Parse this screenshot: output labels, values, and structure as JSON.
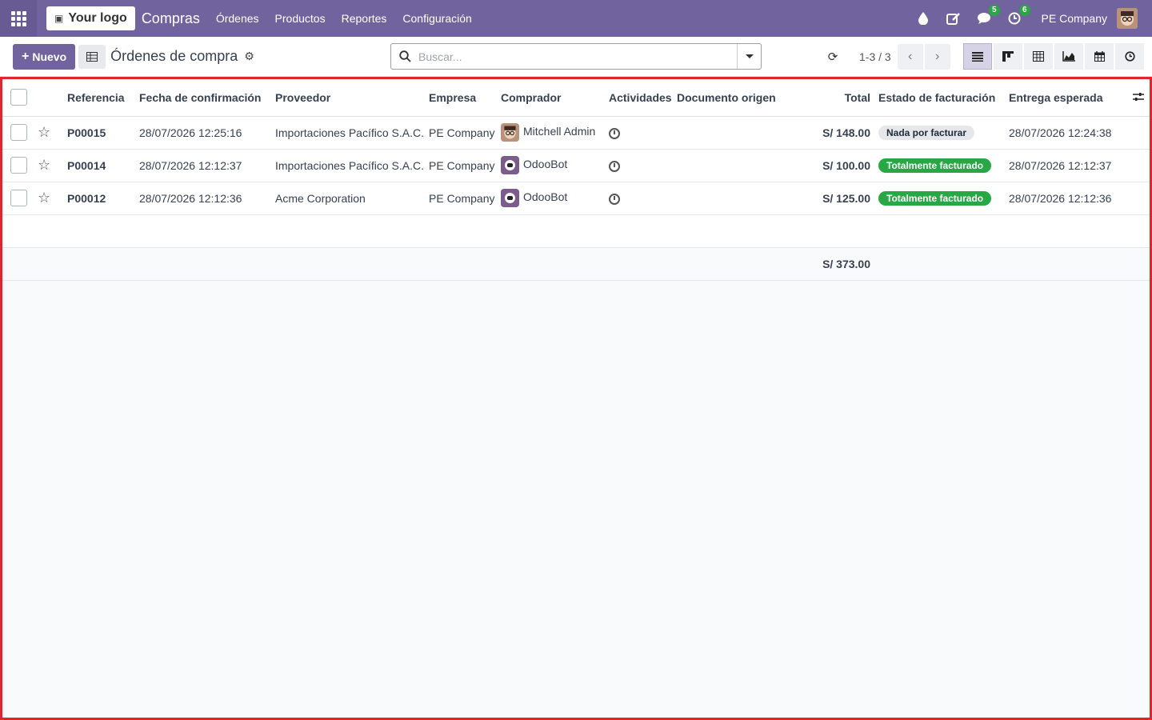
{
  "navbar": {
    "logo_text": "Your logo",
    "app_name": "Compras",
    "menu": [
      "Órdenes",
      "Productos",
      "Reportes",
      "Configuración"
    ],
    "messages_count": "5",
    "activities_count": "6",
    "company": "PE Company"
  },
  "control": {
    "new_label": "Nuevo",
    "breadcrumb": "Órdenes de compra",
    "search_placeholder": "Buscar...",
    "pager": "1-3 / 3"
  },
  "table": {
    "columns": [
      "Referencia",
      "Fecha de confirmación",
      "Proveedor",
      "Empresa",
      "Comprador",
      "Actividades",
      "Documento origen",
      "Total",
      "Estado de facturación",
      "Entrega esperada"
    ],
    "rows": [
      {
        "ref": "P00015",
        "date": "28/07/2026 12:25:16",
        "vendor": "Importaciones Pacífico S.A.C.",
        "company": "PE Company",
        "buyer": "Mitchell Admin",
        "source": "",
        "total": "S/ 148.00",
        "status": "Nada por facturar",
        "status_color": "grey",
        "expected": "28/07/2026 12:24:38"
      },
      {
        "ref": "P00014",
        "date": "28/07/2026 12:12:37",
        "vendor": "Importaciones Pacífico S.A.C.",
        "company": "PE Company",
        "buyer": "OdooBot",
        "source": "",
        "total": "S/ 100.00",
        "status": "Totalmente facturado",
        "status_color": "green",
        "expected": "28/07/2026 12:12:37"
      },
      {
        "ref": "P00012",
        "date": "28/07/2026 12:12:36",
        "vendor": "Acme Corporation",
        "company": "PE Company",
        "buyer": "OdooBot",
        "source": "",
        "total": "S/ 125.00",
        "status": "Totalmente facturado",
        "status_color": "green",
        "expected": "28/07/2026 12:12:36"
      }
    ],
    "sum_total": "S/ 373.00"
  },
  "colors": {
    "brand": "#71639e",
    "highlight_border": "#e2242d",
    "badge_green": "#28a745"
  }
}
